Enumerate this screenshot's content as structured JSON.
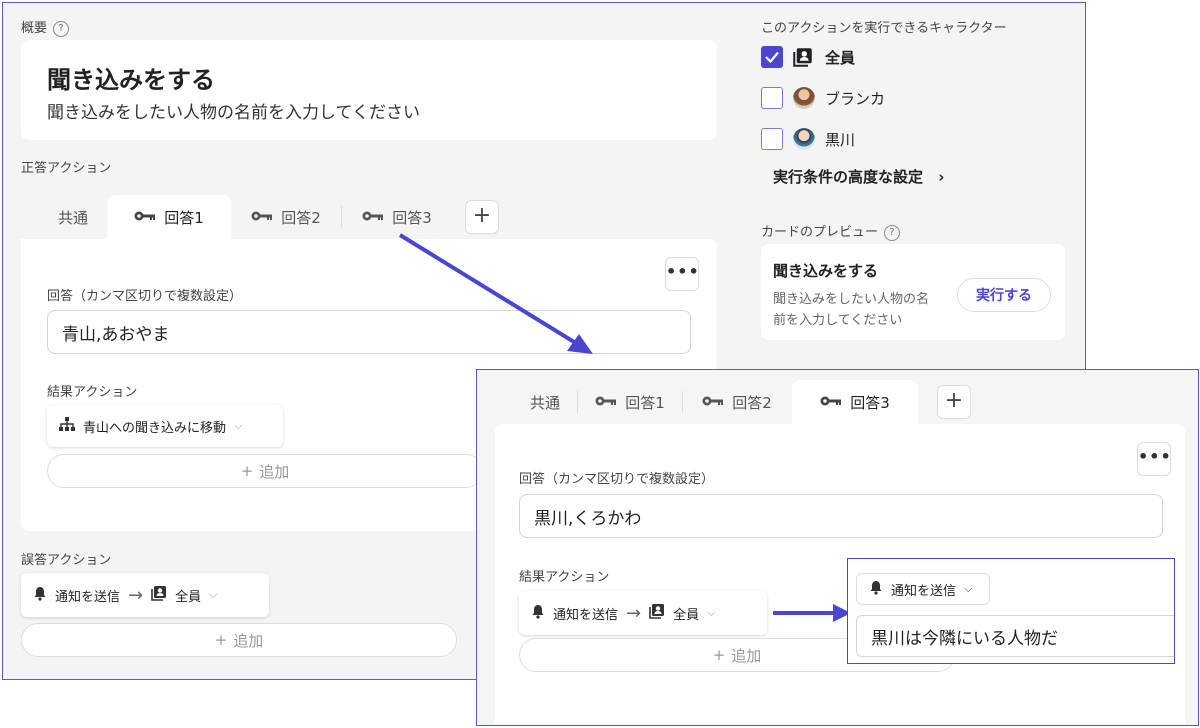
{
  "overview": {
    "label": "概要",
    "help": "?",
    "title": "聞き込みをする",
    "subtitle": "聞き込みをしたい人物の名前を入力してください"
  },
  "correct": {
    "label": "正答アクション",
    "tabs": [
      "共通",
      "回答1",
      "回答2",
      "回答3"
    ],
    "add_tab": "+",
    "more": "•••",
    "answer_label": "回答（カンマ区切りで複数設定）",
    "answer_value": "青山,あおやま",
    "result_label": "結果アクション",
    "result_action": "青山への聞き込みに移動",
    "add_label": "追加"
  },
  "wrong": {
    "label": "誤答アクション",
    "action_from": "通知を送信",
    "action_to": "全員",
    "add_label": "追加"
  },
  "characters": {
    "label": "このアクションを実行できるキャラクター",
    "items": [
      {
        "name": "全員",
        "checked": true
      },
      {
        "name": "ブランカ",
        "checked": false
      },
      {
        "name": "黒川",
        "checked": false
      }
    ],
    "advanced": "実行条件の高度な設定"
  },
  "preview": {
    "label": "カードのプレビュー",
    "help": "?",
    "title": "聞き込みをする",
    "text_line1": "聞き込みをしたい人物の名",
    "text_line2": "前を入力してください",
    "run_button": "実行する"
  },
  "zoom": {
    "tabs": [
      "共通",
      "回答1",
      "回答2",
      "回答3"
    ],
    "add_tab": "+",
    "more": "•••",
    "answer_label": "回答（カンマ区切りで複数設定）",
    "answer_value": "黒川,くろかわ",
    "result_label": "結果アクション",
    "action_from": "通知を送信",
    "action_to": "全員",
    "add_label": "追加",
    "detail_action": "通知を送信",
    "detail_message": "黒川は今隣にいる人物だ"
  },
  "colors": {
    "accent": "#4a46d0",
    "border_highlight": "#5b58d6"
  }
}
